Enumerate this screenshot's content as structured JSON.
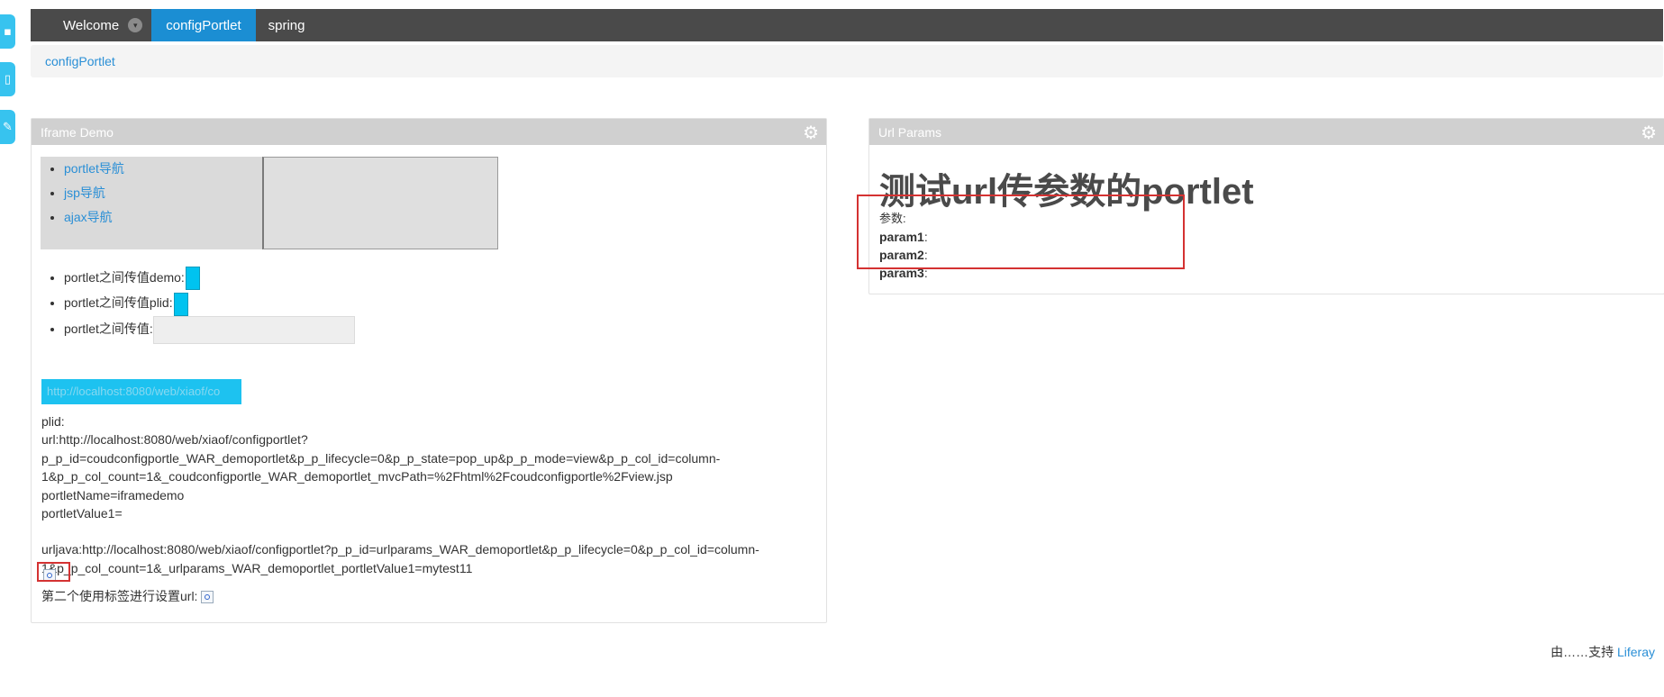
{
  "dock": {
    "btn1_icon": "▪",
    "btn2_icon": "▯",
    "btn3_icon": "✎"
  },
  "topnav": {
    "welcome": "Welcome",
    "caret": "▾",
    "active": "configPortlet",
    "spring": "spring"
  },
  "breadcrumb": {
    "label": "configPortlet"
  },
  "iframe_demo": {
    "title": "Iframe Demo",
    "gear": "⚙",
    "nav_links": [
      "portlet导航",
      "jsp导航",
      "ajax导航"
    ],
    "ipc": [
      "portlet之间传值demo:",
      "portlet之间传值plid:",
      "portlet之间传值:"
    ],
    "url_field": "http://localhost:8080/web/xiaof/co",
    "plid": "plid:",
    "url": "url:http://localhost:8080/web/xiaof/configportlet?\np_p_id=coudconfigportle_WAR_demoportlet&p_p_lifecycle=0&p_p_state=pop_up&p_p_mode=view&p_p_col_id=column-\n1&p_p_col_count=1&_coudconfigportle_WAR_demoportlet_mvcPath=%2Fhtml%2Fcoudconfigportle%2Fview.jsp",
    "portlet_name": "portletName=iframedemo",
    "portlet_value": "portletValue1=",
    "urljava": "urljava:http://localhost:8080/web/xiaof/configportlet?p_p_id=urlparams_WAR_demoportlet&p_p_lifecycle=0&p_p_col_id=column-\n1&p_p_col_count=1&_urlparams_WAR_demoportlet_portletValue1=mytest11",
    "second_label": "第二个使用标签进行设置url:"
  },
  "url_params": {
    "title": "Url Params",
    "gear": "⚙",
    "heading": "测试url传参数的portlet",
    "params_label": "参数:",
    "params": [
      {
        "name": "param1",
        "sep": ":"
      },
      {
        "name": "param2",
        "sep": ":"
      },
      {
        "name": "param3",
        "sep": ":"
      }
    ]
  },
  "footer": {
    "text": "由……支持",
    "link": "Liferay"
  }
}
